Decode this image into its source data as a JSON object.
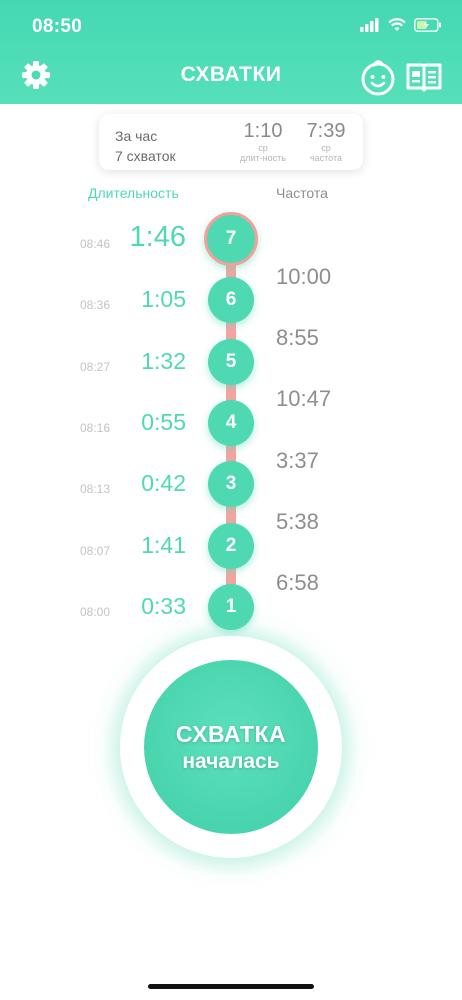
{
  "status": {
    "time": "08:50"
  },
  "header": {
    "title": "СХВАТКИ"
  },
  "summary": {
    "period": "За час",
    "count": "7 схваток",
    "avg_duration": "1:10",
    "avg_duration_sub1": "ср",
    "avg_duration_sub2": "длит-ность",
    "avg_frequency": "7:39",
    "avg_frequency_sub1": "ср",
    "avg_frequency_sub2": "частота"
  },
  "labels": {
    "duration": "Длительность",
    "frequency": "Частота"
  },
  "contractions": [
    {
      "n": "7",
      "time": "08:46",
      "duration": "1:46"
    },
    {
      "n": "6",
      "time": "08:36",
      "duration": "1:05"
    },
    {
      "n": "5",
      "time": "08:27",
      "duration": "1:32"
    },
    {
      "n": "4",
      "time": "08:16",
      "duration": "0:55"
    },
    {
      "n": "3",
      "time": "08:13",
      "duration": "0:42"
    },
    {
      "n": "2",
      "time": "08:07",
      "duration": "1:41"
    },
    {
      "n": "1",
      "time": "08:00",
      "duration": "0:33"
    }
  ],
  "frequencies": [
    "10:00",
    "8:55",
    "10:47",
    "3:37",
    "5:38",
    "6:58"
  ],
  "main_button": {
    "line1": "СХВАТКА",
    "line2": "началась"
  },
  "colors": {
    "accent": "#4fd9b3",
    "line": "#f7a3a0"
  }
}
